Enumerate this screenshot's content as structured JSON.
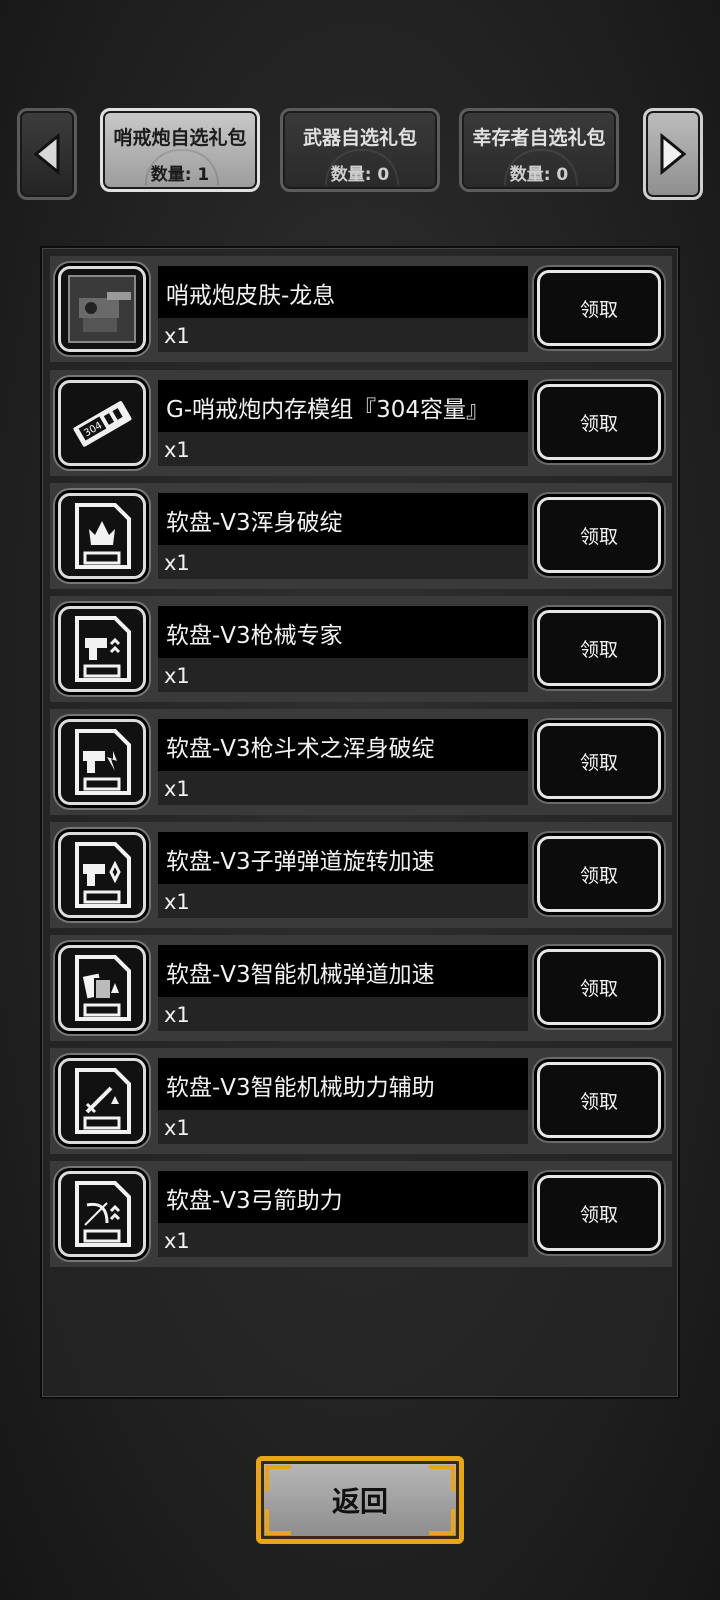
{
  "tabs": [
    {
      "title": "哨戒炮自选礼包",
      "count": "数量: 1",
      "active": true
    },
    {
      "title": "武器自选礼包",
      "count": "数量: 0",
      "active": false
    },
    {
      "title": "幸存者自选礼包",
      "count": "数量: 0",
      "active": false
    }
  ],
  "items": [
    {
      "name": "哨戒炮皮肤-龙息",
      "qty": "x1",
      "icon": "turret-skin-icon",
      "button": "领取"
    },
    {
      "name": "G-哨戒炮内存模组『304容量』",
      "qty": "x1",
      "icon": "memory-module-icon",
      "button": "领取"
    },
    {
      "name": "软盘-V3浑身破绽",
      "qty": "x1",
      "icon": "floppy-disk-icon",
      "button": "领取"
    },
    {
      "name": "软盘-V3枪械专家",
      "qty": "x1",
      "icon": "floppy-disk-gun-icon",
      "button": "领取"
    },
    {
      "name": "软盘-V3枪斗术之浑身破绽",
      "qty": "x1",
      "icon": "floppy-disk-gun-icon",
      "button": "领取"
    },
    {
      "name": "软盘-V3子弹弹道旋转加速",
      "qty": "x1",
      "icon": "floppy-disk-gun-icon",
      "button": "领取"
    },
    {
      "name": "软盘-V3智能机械弹道加速",
      "qty": "x1",
      "icon": "floppy-disk-drone-icon",
      "button": "领取"
    },
    {
      "name": "软盘-V3智能机械助力辅助",
      "qty": "x1",
      "icon": "floppy-disk-sword-icon",
      "button": "领取"
    },
    {
      "name": "软盘-V3弓箭助力",
      "qty": "x1",
      "icon": "floppy-disk-bow-icon",
      "button": "领取"
    }
  ],
  "back_button": "返回",
  "colors": {
    "accent_gold": "#e7a51a",
    "tab_active": "#bdbdbd",
    "row_bg": "#3a3a3a"
  }
}
